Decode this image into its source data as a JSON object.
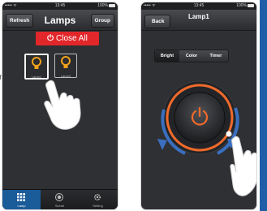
{
  "left_label": "n",
  "phone1": {
    "status": {
      "carrier": "••••• ᯤ",
      "time": "13:45",
      "battery": "100%"
    },
    "nav": {
      "title": "Lamps",
      "left_button": "Refresh",
      "right_button": "Group"
    },
    "close_all": "Close All",
    "lamps": [
      {
        "label": "Lamp1",
        "selected": true
      },
      {
        "label": "Lamp2",
        "selected": false
      }
    ],
    "tabs": [
      {
        "label": "Lamp",
        "icon": "grid-icon",
        "active": true
      },
      {
        "label": "Scene",
        "icon": "scene-icon",
        "active": false
      },
      {
        "label": "Setting",
        "icon": "gear-icon",
        "active": false
      }
    ]
  },
  "phone2": {
    "status": {
      "carrier": "••••• ᯤ",
      "time": "13:45",
      "battery": "100%"
    },
    "nav": {
      "title": "Lamp1",
      "back_button": "Back"
    },
    "segments": [
      {
        "label": "Bright",
        "selected": true
      },
      {
        "label": "Color",
        "selected": false
      },
      {
        "label": "Timer",
        "selected": false
      }
    ],
    "dial": {
      "power_icon": "power-icon"
    }
  },
  "colors": {
    "accent_red": "#e2272b",
    "lamp_orange": "#f0a21a",
    "dial_orange": "#f06a2b",
    "tab_blue": "#1a5b99",
    "arrow_blue": "#3a6fc0",
    "strip_blue": "#1e5ea6"
  }
}
